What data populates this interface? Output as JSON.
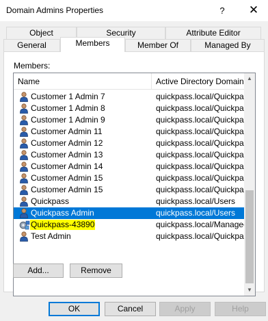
{
  "window": {
    "title": "Domain Admins Properties",
    "help_glyph": "?",
    "close_glyph": "✕"
  },
  "tabs": {
    "row1": [
      "Object",
      "Security",
      "Attribute Editor"
    ],
    "row2": [
      "General",
      "Members",
      "Member Of",
      "Managed By"
    ],
    "active": "Members"
  },
  "members": {
    "label": "Members:",
    "columns": [
      "Name",
      "Active Directory Domain Ser"
    ],
    "rows": [
      {
        "name": "Customer 1 Admin 7",
        "path": "quickpass.local/Quickpass/",
        "icon": "user-icon"
      },
      {
        "name": "Customer 1 Admin 8",
        "path": "quickpass.local/Quickpass/",
        "icon": "user-icon"
      },
      {
        "name": "Customer 1 Admin 9",
        "path": "quickpass.local/Quickpass/",
        "icon": "user-icon"
      },
      {
        "name": "Customer Admin 11",
        "path": "quickpass.local/Quickpass/",
        "icon": "user-icon"
      },
      {
        "name": "Customer Admin 12",
        "path": "quickpass.local/Quickpass/",
        "icon": "user-icon"
      },
      {
        "name": "Customer Admin 13",
        "path": "quickpass.local/Quickpass/",
        "icon": "user-icon"
      },
      {
        "name": "Customer Admin 14",
        "path": "quickpass.local/Quickpass/",
        "icon": "user-icon"
      },
      {
        "name": "Customer Admin 15",
        "path": "quickpass.local/Quickpass/",
        "icon": "user-icon"
      },
      {
        "name": "Customer Admin 15",
        "path": "quickpass.local/Quickpass/",
        "icon": "user-icon"
      },
      {
        "name": "Quickpass",
        "path": "quickpass.local/Users",
        "icon": "user-icon"
      },
      {
        "name": "Quickpass Admin",
        "path": "quickpass.local/Users",
        "icon": "user-icon",
        "selected": true
      },
      {
        "name": "Quickpass-43890",
        "path": "quickpass.local/Managed S",
        "icon": "service-account-icon",
        "highlight": true
      },
      {
        "name": "Test Admin",
        "path": "quickpass.local/Quickpass/",
        "icon": "user-icon"
      }
    ]
  },
  "buttons": {
    "add": "Add...",
    "remove": "Remove",
    "ok": "OK",
    "cancel": "Cancel",
    "apply": "Apply",
    "help": "Help"
  },
  "colors": {
    "selection": "#0078d7",
    "highlight": "#ffff00"
  }
}
